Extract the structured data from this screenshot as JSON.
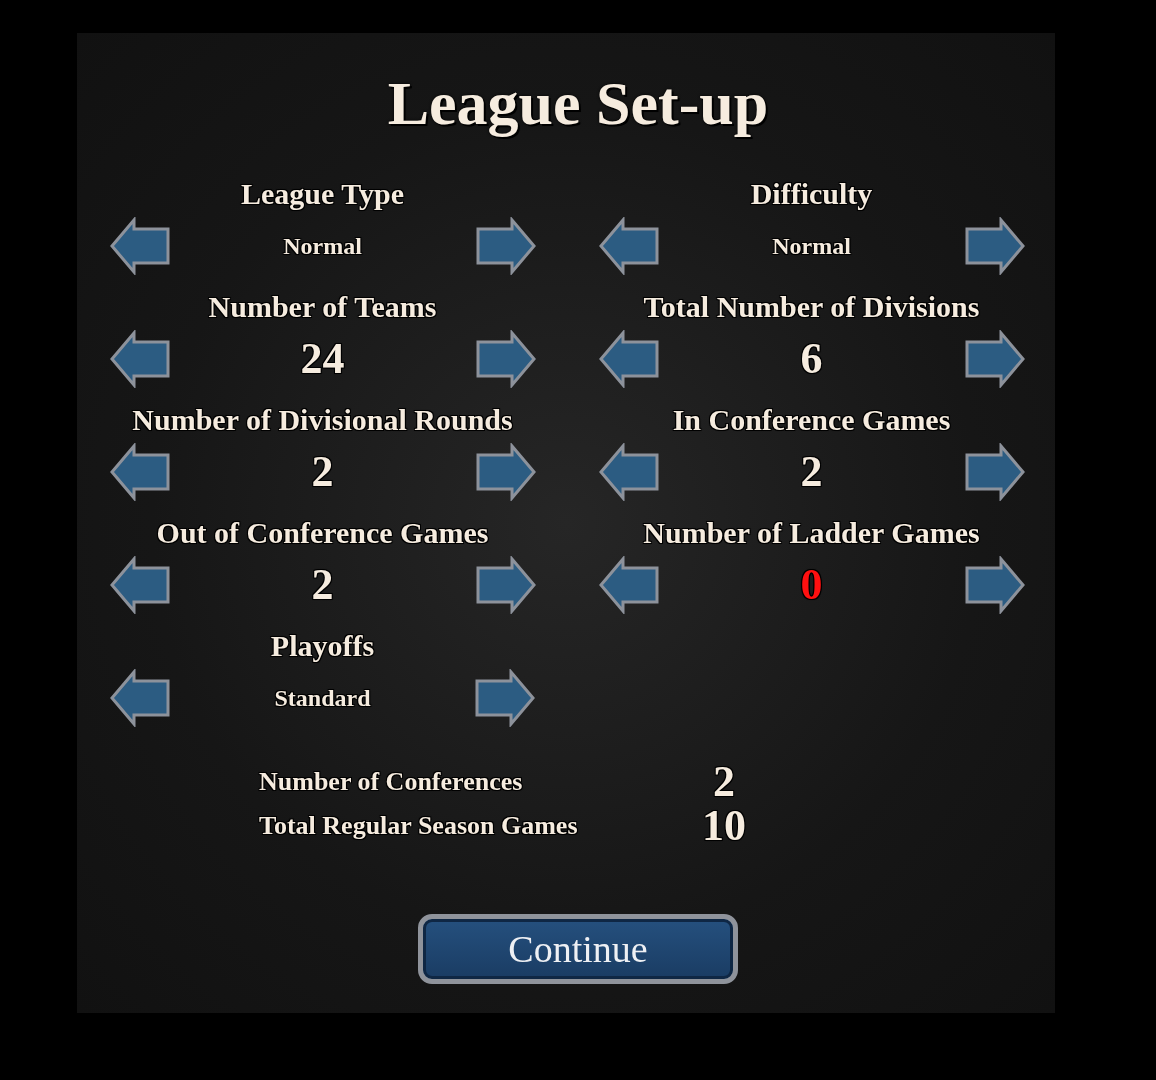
{
  "title": "League Set-up",
  "settings": [
    {
      "label": "League Type",
      "value": "Normal",
      "kind": "word",
      "alert": false
    },
    {
      "label": "Difficulty",
      "value": "Normal",
      "kind": "word",
      "alert": false
    },
    {
      "label": "Number of Teams",
      "value": "24",
      "kind": "number",
      "alert": false
    },
    {
      "label": "Total Number of Divisions",
      "value": "6",
      "kind": "number",
      "alert": false
    },
    {
      "label": "Number of Divisional Rounds",
      "value": "2",
      "kind": "number",
      "alert": false
    },
    {
      "label": "In Conference Games",
      "value": "2",
      "kind": "number",
      "alert": false
    },
    {
      "label": "Out of Conference Games",
      "value": "2",
      "kind": "number",
      "alert": false
    },
    {
      "label": "Number of Ladder Games",
      "value": "0",
      "kind": "number",
      "alert": true
    },
    {
      "label": "Playoffs",
      "value": "Standard",
      "kind": "word",
      "alert": false
    }
  ],
  "summary": [
    {
      "label": "Number of Conferences",
      "value": "2"
    },
    {
      "label": "Total Regular Season Games",
      "value": "10"
    }
  ],
  "continue_button": "Continue"
}
